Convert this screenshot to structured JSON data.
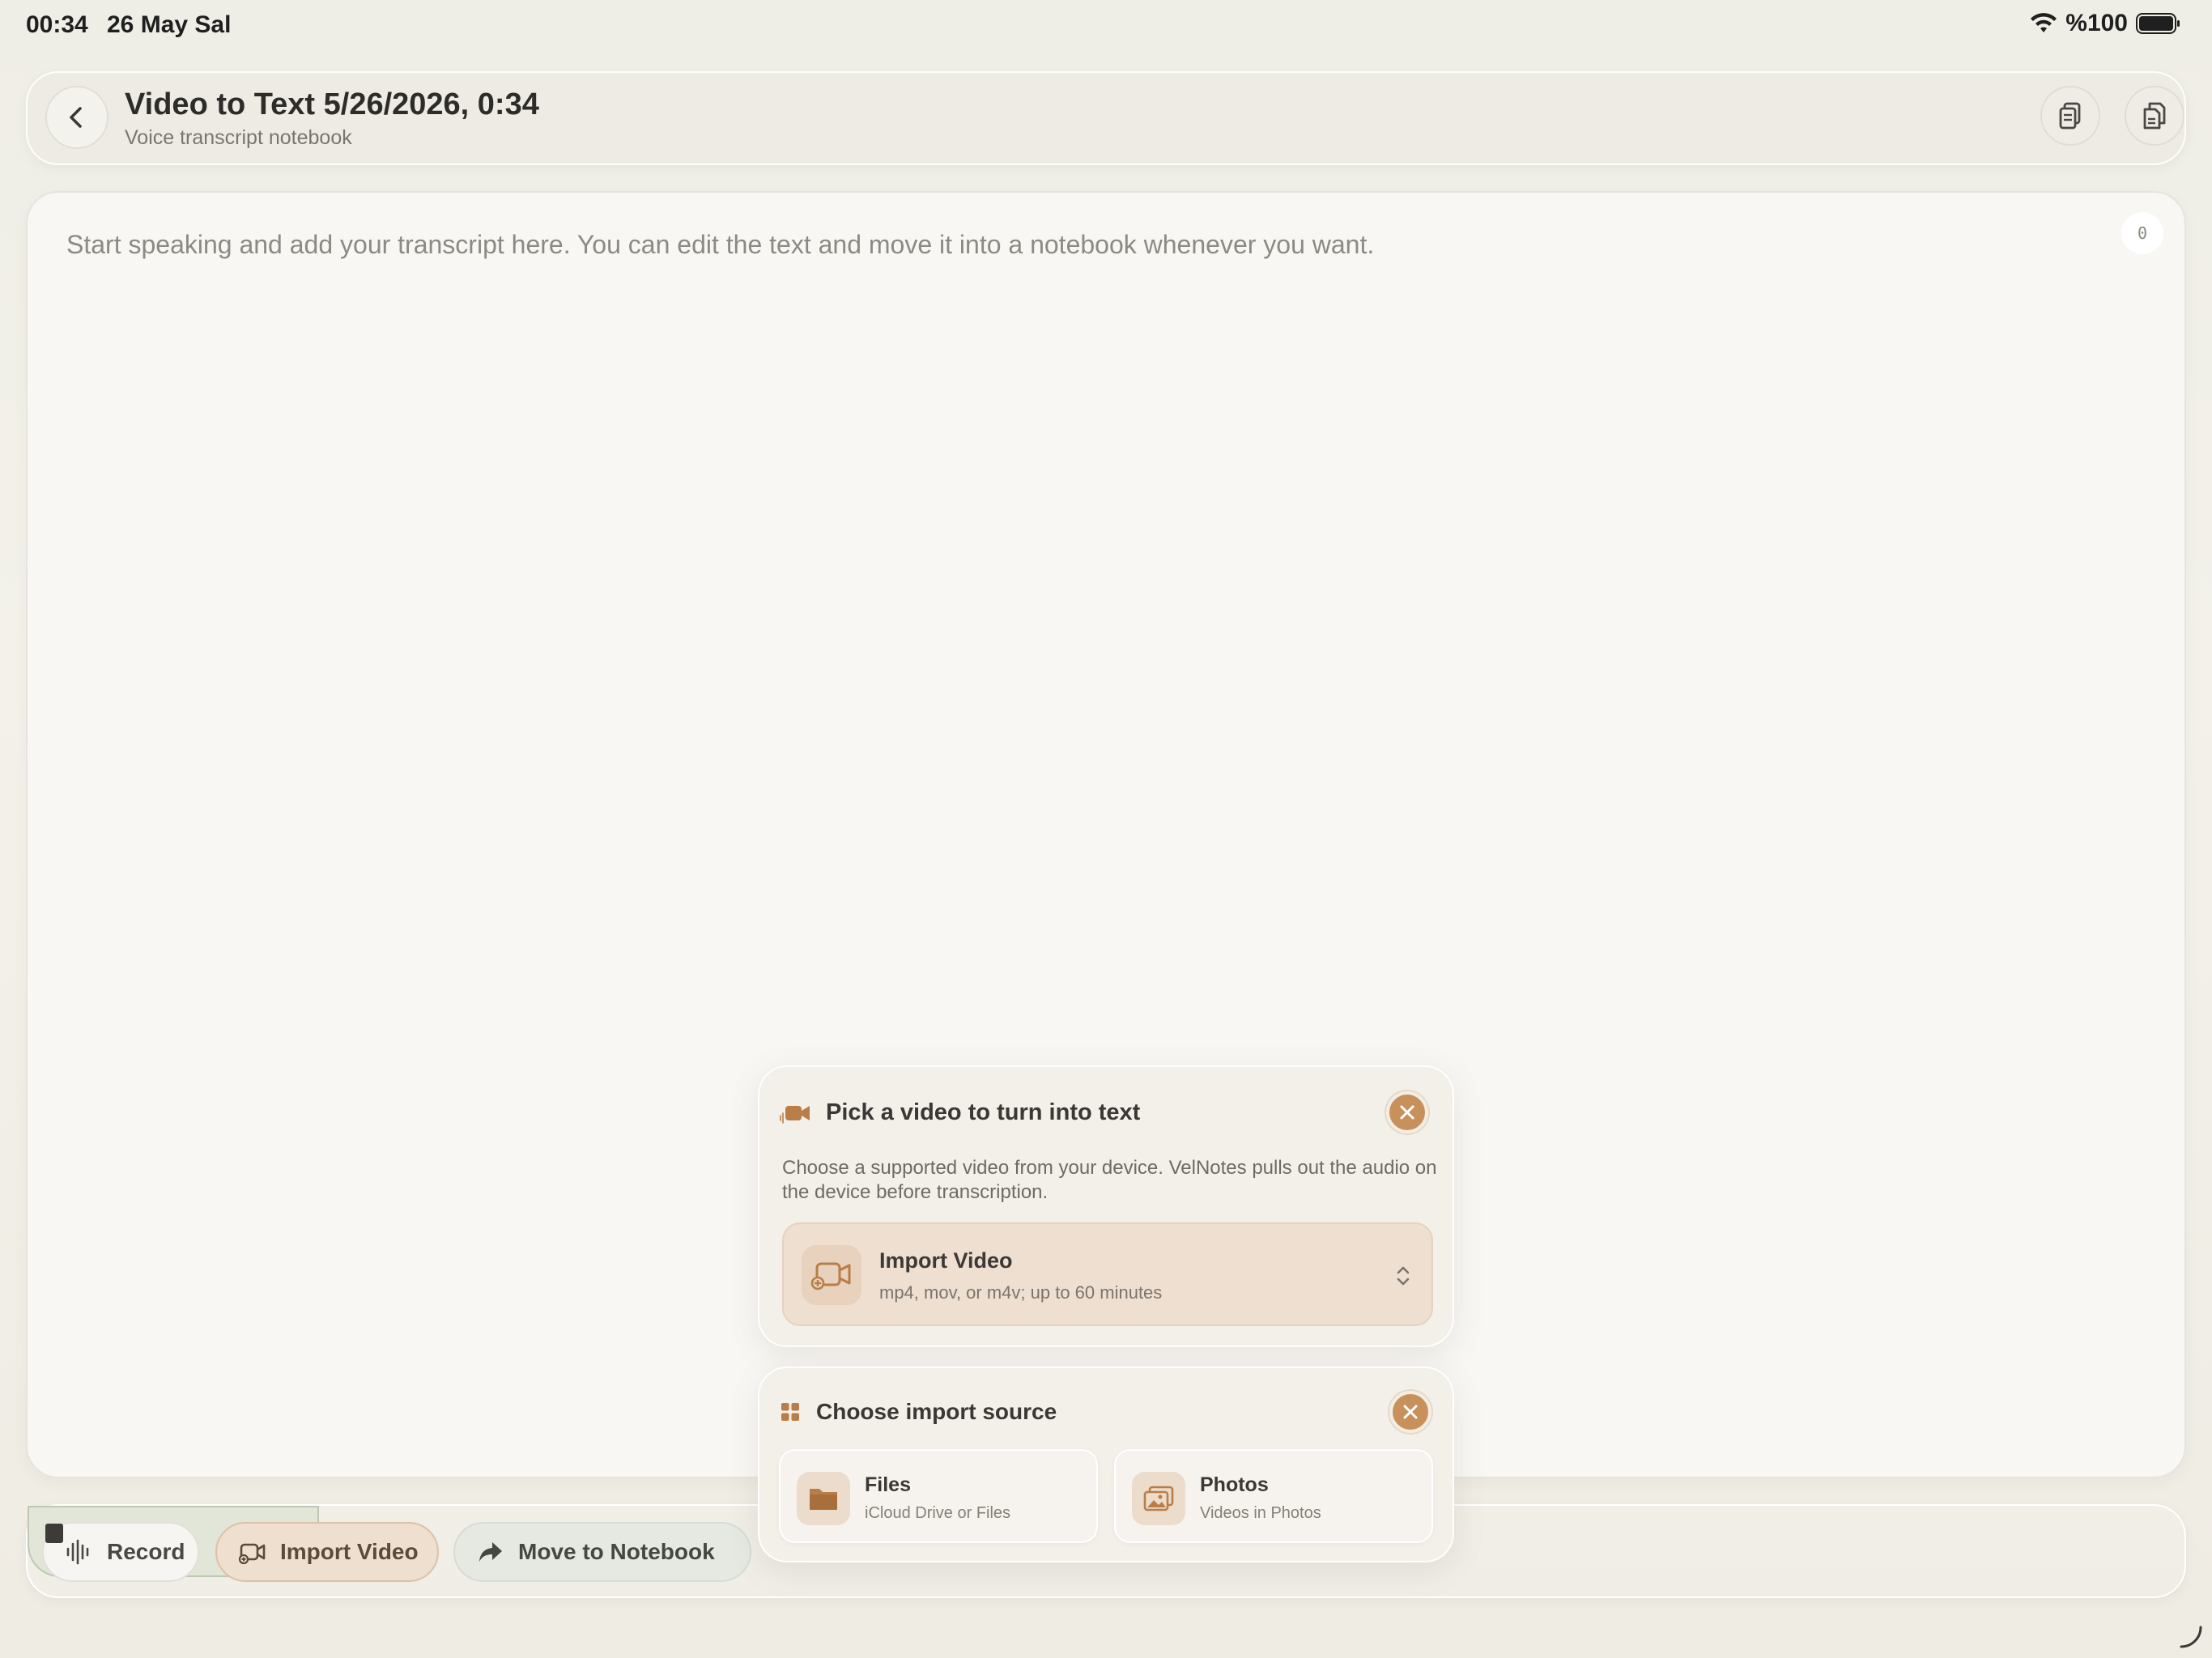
{
  "status_bar": {
    "time": "00:34",
    "date": "26 May Sal",
    "battery": "%100",
    "wifi_icon": "wifi-icon",
    "battery_icon": "battery-icon"
  },
  "header": {
    "title": "Video to Text 5/26/2026, 0:34",
    "subtitle": "Voice transcript notebook",
    "back_icon": "chevron-left-icon",
    "actions": [
      "copy-icon",
      "document-copy-icon"
    ]
  },
  "editor": {
    "placeholder": "Start speaking and add your transcript here. You can edit the text and move it into a notebook whenever you want.",
    "char_count": "0"
  },
  "toolbar": {
    "record_label": "Record",
    "import_label": "Import Video",
    "move_label": "Move to Notebook"
  },
  "video_popover": {
    "title": "Pick a video to turn into text",
    "description": "Choose a supported video from your device. VelNotes pulls out the audio on the device before transcription.",
    "option_title": "Import Video",
    "option_subtitle": "mp4, mov, or m4v; up to 60 minutes"
  },
  "source_popover": {
    "title": "Choose import source",
    "sources": [
      {
        "title": "Files",
        "subtitle": "iCloud Drive or Files",
        "icon": "folder-icon"
      },
      {
        "title": "Photos",
        "subtitle": "Videos in Photos",
        "icon": "photos-icon"
      }
    ]
  },
  "colors": {
    "accent": "#c8915c",
    "background": "#efeee6",
    "editor_bg": "#f8f7f4"
  }
}
